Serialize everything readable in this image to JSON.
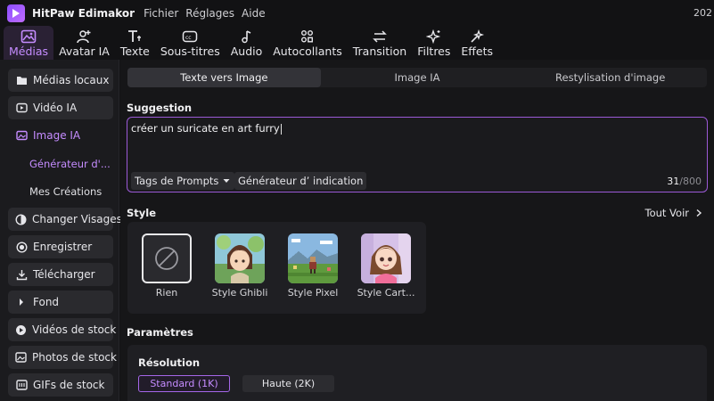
{
  "app": {
    "name": "HitPaw Edimakor",
    "year_fragment": "202"
  },
  "menu": [
    "Fichier",
    "Réglages",
    "Aide"
  ],
  "toolbar": [
    {
      "label": "Médias",
      "icon": "image-icon",
      "active": true
    },
    {
      "label": "Avatar IA",
      "icon": "avatar-add-icon",
      "active": false
    },
    {
      "label": "Texte",
      "icon": "text-icon",
      "active": false
    },
    {
      "label": "Sous-titres",
      "icon": "subtitles-icon",
      "active": false
    },
    {
      "label": "Audio",
      "icon": "music-icon",
      "active": false
    },
    {
      "label": "Autocollants",
      "icon": "stickers-icon",
      "active": false
    },
    {
      "label": "Transition",
      "icon": "transition-icon",
      "active": false
    },
    {
      "label": "Filtres",
      "icon": "filter-icon",
      "active": false
    },
    {
      "label": "Effets",
      "icon": "effects-icon",
      "active": false
    }
  ],
  "sidebar": {
    "items": [
      {
        "label": "Médias locaux",
        "icon": "folder-icon"
      },
      {
        "label": "Vidéo IA",
        "icon": "video-ai-icon"
      },
      {
        "label": "Image IA",
        "icon": "image-ai-icon",
        "active": true
      },
      {
        "label": "Changer Visages",
        "icon": "face-swap-icon"
      },
      {
        "label": "Enregistrer",
        "icon": "record-icon"
      },
      {
        "label": "Télécharger",
        "icon": "download-icon"
      },
      {
        "label": "Fond",
        "icon": "caret-right-icon"
      },
      {
        "label": "Vidéos de stock",
        "icon": "stock-video-icon"
      },
      {
        "label": "Photos de stock",
        "icon": "stock-photo-icon"
      },
      {
        "label": "GIFs de stock",
        "icon": "gif-icon"
      }
    ],
    "subitems": [
      {
        "label": "Générateur d'...",
        "active": true
      },
      {
        "label": "Mes Créations",
        "active": false
      }
    ]
  },
  "tabs": [
    {
      "label": "Texte vers Image",
      "active": true
    },
    {
      "label": "Image IA",
      "active": false
    },
    {
      "label": "Restylisation d'image",
      "active": false
    }
  ],
  "suggestion": {
    "title": "Suggestion",
    "value": "créer un suricate en art furry",
    "tags_button": "Tags de Prompts",
    "generator_button": "Générateur d’  indication",
    "count": "31",
    "max": "/800"
  },
  "style": {
    "title": "Style",
    "see_all": "Tout Voir",
    "options": [
      {
        "label": "Rien",
        "selected": true
      },
      {
        "label": "Style Ghibli",
        "selected": false
      },
      {
        "label": "Style Pixel",
        "selected": false
      },
      {
        "label": "Style Cart...",
        "selected": false
      }
    ]
  },
  "params": {
    "title": "Paramètres",
    "resolution_title": "Résolution",
    "resolutions": [
      {
        "label": "Standard (1K)",
        "active": true
      },
      {
        "label": "Haute (2K)",
        "active": false
      }
    ]
  },
  "colors": {
    "accent": "#c58cff",
    "bg": "#121214",
    "panel": "#1f1f23"
  }
}
